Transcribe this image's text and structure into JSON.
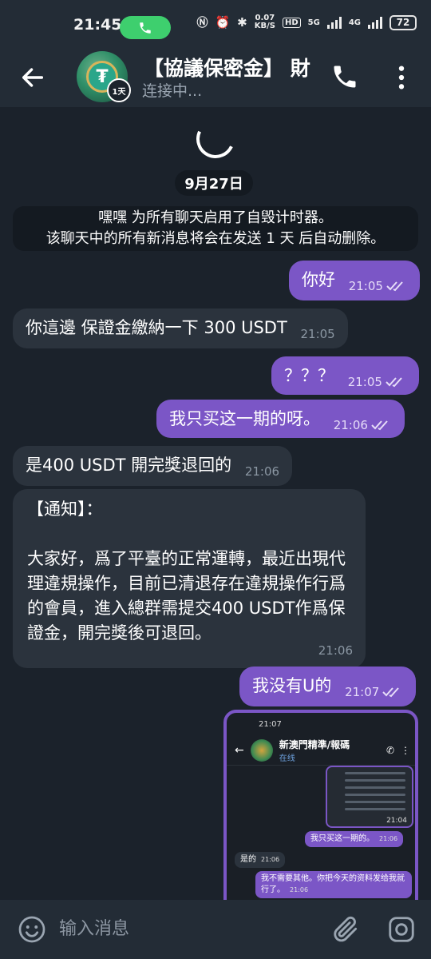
{
  "status": {
    "time": "21:45",
    "speed_top": "0.07",
    "speed_bottom": "KB/S",
    "hd": "HD",
    "net1": "5G",
    "net2": "4G",
    "battery": "72"
  },
  "header": {
    "title": "【協議保密金】 財",
    "status": "连接中...",
    "timer_badge": "1天",
    "avatar_text": "USDT"
  },
  "chat": {
    "date": "9月27日",
    "service_line1": "嘿嘿 为所有聊天启用了自毁计时器。",
    "service_line2": "该聊天中的所有新消息将会在发送 1 天 后自动删除。",
    "messages": [
      {
        "text": "你好",
        "time": "21:05"
      },
      {
        "text": "你這邊 保證金繳納一下 300 USDT",
        "time": "21:05"
      },
      {
        "text": "？？？",
        "time": "21:05"
      },
      {
        "text": "我只买这一期的呀。",
        "time": "21:06"
      },
      {
        "text": "是400  USDT 開完獎退回的",
        "time": "21:06"
      },
      {
        "text": "【通知】：\n\n大家好，爲了平臺的正常運轉，最近出現代理違規操作，目前已清退存在違規操作行爲的會員，進入總群需提交400 USDT作爲保證金，開完獎後可退回。",
        "time": "21:06"
      },
      {
        "text": "我没有U的",
        "time": "21:07"
      }
    ]
  },
  "screenshot": {
    "time": "21:07",
    "title": "新澳門精準/報碼",
    "subtitle": "在线",
    "img_time": "21:04",
    "msg1": "我只买这一期的。",
    "msg1_time": "21:06",
    "msg2": "是的",
    "msg2_time": "21:06",
    "msg3": "我不需要其他。你把今天的资料发给我就行了。",
    "msg3_time": "21:06"
  },
  "composer": {
    "placeholder": "输入消息"
  },
  "colors": {
    "outgoing": "#7b56c6",
    "incoming": "#2b333d",
    "background": "#1b222b",
    "bar": "#232c36",
    "call_pill": "#3ecf6e"
  },
  "icons": [
    "back-arrow-icon",
    "phone-icon",
    "more-vertical-icon",
    "emoji-icon",
    "attach-icon",
    "camera-icon",
    "double-check-icon",
    "loading-spinner-icon"
  ]
}
